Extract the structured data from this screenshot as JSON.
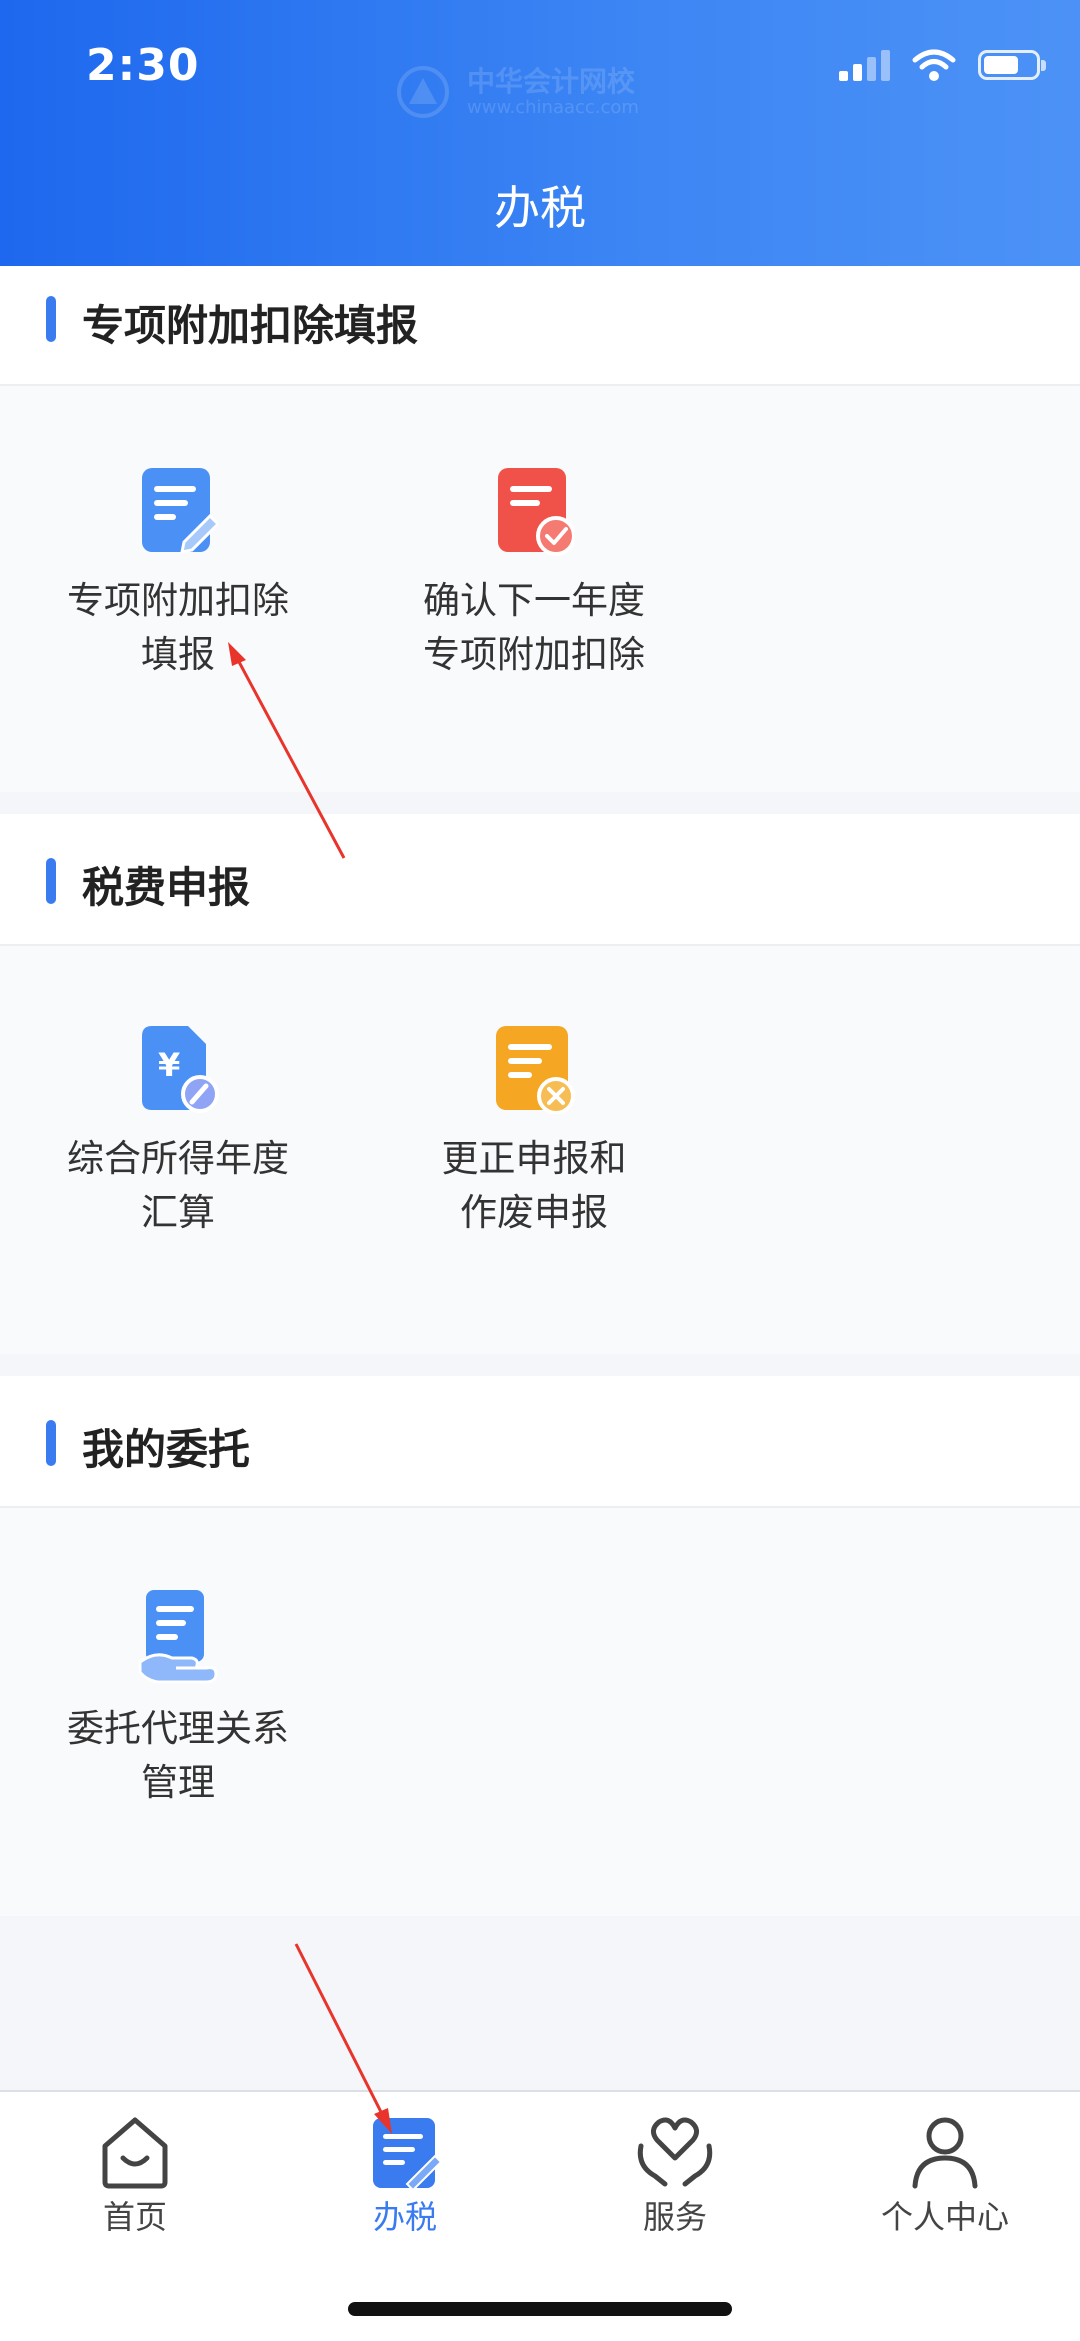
{
  "status_bar": {
    "time": "2:30"
  },
  "watermark": {
    "name": "中华会计网校",
    "url": "www.chinaacc.com"
  },
  "header": {
    "title": "办税"
  },
  "sections": [
    {
      "title": "专项附加扣除填报",
      "tiles": [
        {
          "icon": "edit-document-icon",
          "color": "#4a90f5",
          "line1": "专项附加扣除",
          "line2": "填报"
        },
        {
          "icon": "confirm-document-icon",
          "color": "#f0524a",
          "line1": "确认下一年度",
          "line2": "专项附加扣除"
        }
      ]
    },
    {
      "title": "税费申报",
      "tiles": [
        {
          "icon": "yuan-document-icon",
          "color": "#4a90f5",
          "line1": "综合所得年度",
          "line2": "汇算"
        },
        {
          "icon": "cancel-document-icon",
          "color": "#f5a623",
          "line1": "更正申报和",
          "line2": "作废申报"
        }
      ]
    },
    {
      "title": "我的委托",
      "tiles": [
        {
          "icon": "delegate-document-icon",
          "color": "#4a90f5",
          "line1": "委托代理关系",
          "line2": "管理"
        }
      ]
    }
  ],
  "bottom_nav": [
    {
      "label": "首页",
      "icon": "home-icon",
      "active": false
    },
    {
      "label": "办税",
      "icon": "tax-document-icon",
      "active": true
    },
    {
      "label": "服务",
      "icon": "heart-hands-icon",
      "active": false
    },
    {
      "label": "个人中心",
      "icon": "person-icon",
      "active": false
    }
  ],
  "colors": {
    "primary": "#3a7bf0",
    "header_start": "#1d68ee",
    "header_end": "#4c92f6",
    "annotation_arrow": "#e8342b"
  }
}
